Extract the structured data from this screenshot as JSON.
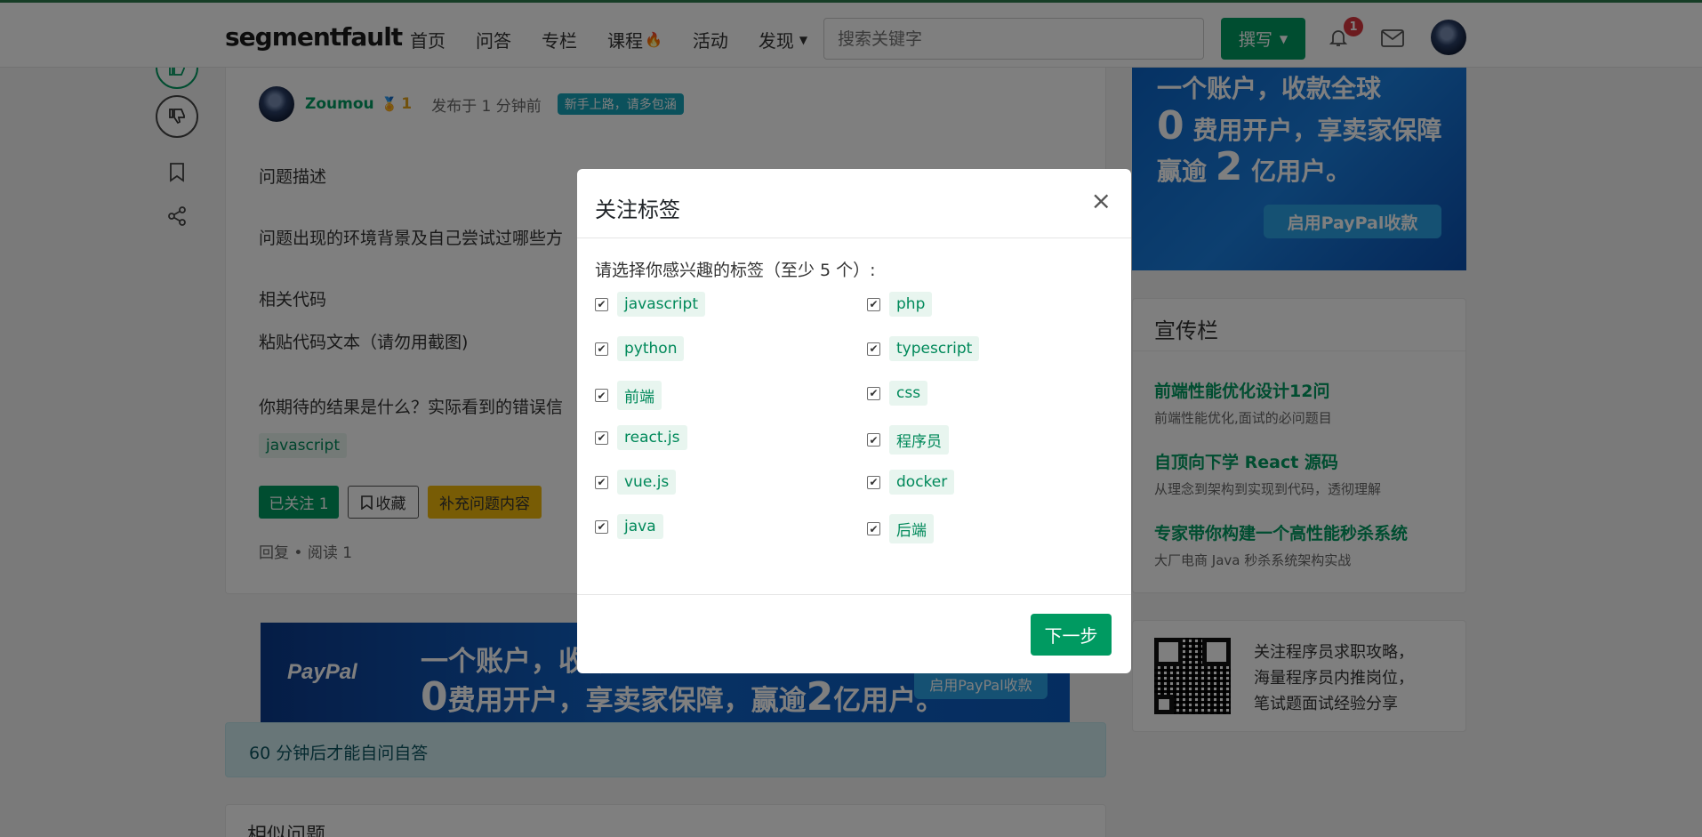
{
  "topbar": {
    "logo_text": "segmentfault",
    "nav": [
      {
        "label": "首页"
      },
      {
        "label": "问答"
      },
      {
        "label": "专栏"
      },
      {
        "label": "课程"
      },
      {
        "label": "活动"
      },
      {
        "label": "发现"
      }
    ],
    "search_placeholder": "搜索关键字",
    "write_label": "撰写",
    "notification_count": "1",
    "accent": "#009a61"
  },
  "question": {
    "author": "Zoumou",
    "reputation": "1",
    "posted": "发布于 1 分钟前",
    "badge": "新手上路，请多包涵",
    "paragraphs": [
      "问题描述",
      "问题出现的环境背景及自己尝试过哪些方",
      "相关代码",
      "粘贴代码文本（请勿用截图)",
      "你期待的结果是什么？实际看到的错误信"
    ],
    "tag": "javascript",
    "followed_label": "已关注 1",
    "favorite_label": "收藏",
    "supplement_label": "补充问题内容",
    "meta": "回复 • 阅读 1"
  },
  "ads": {
    "wide": {
      "brand": "PayPal",
      "line1": "一个账户，收款",
      "line2_big": "0",
      "line2": "费用开户，享卖家保障，赢逾",
      "line2_big2": "2",
      "line2_end": "亿用户。",
      "button": "启用PayPal收款"
    },
    "right": {
      "line1": "一个账户，收款全球",
      "line2_big": "0",
      "line2": "费用开户，享卖家保障",
      "line3_pre": "赢逾",
      "line3_big": "2",
      "line3_end": "亿用户。",
      "button": "启用PayPal收款"
    }
  },
  "promo": {
    "title": "宣传栏",
    "items": [
      {
        "title": "前端性能优化设计12问",
        "sub": "前端性能优化,面试的必问题目"
      },
      {
        "title": "自顶向下学 React 源码",
        "sub": "从理念到架构到实现到代码，透彻理解"
      },
      {
        "title": "专家带你构建一个高性能秒杀系统",
        "sub": "大厂电商 Java 秒杀系统架构实战"
      }
    ]
  },
  "qr": {
    "lines": [
      "关注程序员求职攻略，",
      "海量程序员内推岗位，",
      "笔试题面试经验分享"
    ]
  },
  "notice": "60 分钟后才能自问自答",
  "similar_title": "相似问题",
  "modal": {
    "title": "关注标签",
    "close": "×",
    "prompt": "请选择你感兴趣的标签（至少 5 个）:",
    "tags_left": [
      "javascript",
      "python",
      "前端",
      "react.js",
      "vue.js",
      "java"
    ],
    "tags_right": [
      "php",
      "typescript",
      "css",
      "程序员",
      "docker",
      "后端"
    ],
    "checked": true,
    "next_label": "下一步"
  }
}
